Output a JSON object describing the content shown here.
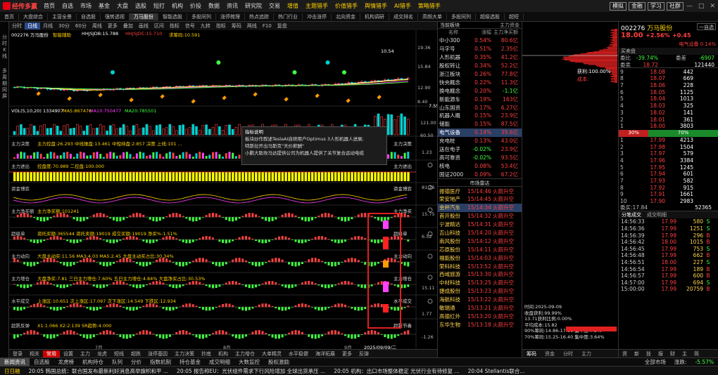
{
  "app": {
    "title": "经传多赢",
    "top_menu": [
      "首页",
      "自选",
      "市场",
      "基金",
      "大盘",
      "选股",
      "短打",
      "机构",
      "价投",
      "数据",
      "资讯",
      "研究院",
      "交易",
      "增值",
      "主题猎手",
      "价值猎手",
      "舆情猎手",
      "AI猎手",
      "策略猎手"
    ],
    "top_right_btns": [
      "模拟",
      "金融",
      "学习",
      "社群"
    ],
    "second_tabs": [
      "首页",
      "大盘综合",
      "主营全景",
      "自选股",
      "强势透视",
      "万马股份",
      "智能选股",
      "多股同列",
      "涨停梳理",
      "热点追踪",
      "热门行业",
      "冲击涨停",
      "北向资金",
      "机构调研",
      "成交排名",
      "高频大单",
      "多股同列",
      "超级选股",
      "超短"
    ],
    "left_strip": [
      "分",
      "时",
      "K",
      "线",
      "多",
      "周",
      "期",
      "同",
      "屏"
    ]
  },
  "chart": {
    "toolbar": [
      "分时",
      "日线",
      "月线",
      "30分",
      "60分",
      "周线",
      "更多",
      "叠加",
      "画线",
      "区间",
      "指标",
      "信号",
      "九转",
      "指标",
      "筹码",
      "两线",
      "F10",
      "复盘"
    ],
    "title_code": "002276 万马股份",
    "smart": "智能辅助",
    "ma_labels": [
      {
        "text": "HHJSJDB:15.788",
        "color": "#ffffff"
      },
      {
        "text": "HHJSJDC:15.710",
        "color": "#ff4040"
      },
      {
        "text": "求筹码:10.591",
        "color": "#ffd200"
      }
    ],
    "price_ticks": [
      "19.36",
      "15.84",
      "12.90",
      "8.40"
    ],
    "annotations": [
      "10.54",
      "7.55"
    ],
    "vol_title": "VOL(5,10,20)",
    "vol_vals": [
      {
        "text": "1334907",
        "color": "#ffffff"
      },
      {
        "text": "MA5:867476",
        "color": "#ffd200"
      },
      {
        "text": "MA10:750477",
        "color": "#ff40ff"
      },
      {
        "text": "MA20:785501",
        "color": "#40ff40"
      }
    ],
    "vol_ticks": [
      "121.00",
      "60.50",
      "0"
    ],
    "panels": [
      {
        "name": "主力决策",
        "vals": "主力控盘:26.293 中线操盘:13.461 中短持盘:2.857 决策 上线:101 ...",
        "right": "主力决策"
      },
      {
        "name": "主力进出",
        "vals": "控盘度:70.989 二控盘:100.000",
        "right": "主力进出"
      },
      {
        "name": "资金博弈",
        "vals": "",
        "right": "资金博弈"
      },
      {
        "name": "主力净买额",
        "vals": "主力净买额:101241",
        "right": "主力净买"
      },
      {
        "name": "超级单",
        "vals": "资托买额:365544 资托卖额:19019 成交买额:19019 净买%:1.51%",
        "right": "超级单"
      },
      {
        "name": "主力动向",
        "vals": "大盘主动买:11.56 MA3:4.03 MA5:2.45 大盘主动买占比:30.34%",
        "right": "主力动向"
      },
      {
        "name": "主力增仓",
        "vals": "大盘净买:7.81 三日主力增仓:7.60% 五日主力增仓:4.84% 大盘净买占比:30.53%",
        "right": "主力增仓"
      },
      {
        "name": "水平成交",
        "vals": "上涨区:10.651 次上涨区:17.097 次下涨区:14.549 下跌区:12.934",
        "right": "水平成交"
      },
      {
        "name": "超跌反弹",
        "vals": "X1:1.066 X2:2.139 SR趋势:4.000",
        "right": "超跌节奏"
      }
    ],
    "panel_ticks": [
      "1.23",
      "81.26",
      "15.75",
      "6.52",
      "15.11",
      "1.77",
      "-1.26"
    ],
    "x_axis": [
      "7月",
      "8月",
      "9月",
      "2025/09/09/二"
    ],
    "bottom_tabs": [
      "登录",
      "相关",
      "常用",
      "设置",
      "主力",
      "龙虎",
      "短线",
      "超跌",
      "涨停基因",
      "主力决策",
      "抄底",
      "机构",
      "主力增仓",
      "大单精灵",
      "水平稳健",
      "海洋拓展",
      "更多",
      "反弹"
    ],
    "tooltip": {
      "title": "指标说明",
      "lines": [
        "板块炒作叙述TeslaAI自研用户Optimus 3人形机器人进展;",
        "特斯拉开出马斯克\"天价薪酬\"",
        "小鹏大助攻马达提供公司为机器人提供了关节复合运动电缆"
      ]
    }
  },
  "sector": {
    "header_left": "当前板块",
    "header_right": "主力资金",
    "cols": [
      "名称",
      "涨幅",
      "主力净买额"
    ],
    "rows": [
      {
        "n": "中小300",
        "p": "0.54%",
        "v": "80.6亿"
      },
      {
        "n": "马字号",
        "p": "0.51%",
        "v": "2.35亿"
      },
      {
        "n": "人形机器",
        "p": "0.35%",
        "v": "41.2亿"
      },
      {
        "n": "股权转让",
        "p": "0.34%",
        "v": "52.2亿"
      },
      {
        "n": "浙江板块",
        "p": "0.26%",
        "v": "77.8亿"
      },
      {
        "n": "快充概念",
        "p": "0.22%",
        "v": "11.3亿"
      },
      {
        "n": "换电概念",
        "p": "0.20%",
        "v": "-1.1亿"
      },
      {
        "n": "新能源车",
        "p": "0.19%",
        "v": "163亿"
      },
      {
        "n": "山东国资",
        "p": "0.17%",
        "v": "6.27亿"
      },
      {
        "n": "机器人概",
        "p": "0.15%",
        "v": "23.9亿"
      },
      {
        "n": "储能",
        "p": "0.15%",
        "v": "87.5亿"
      },
      {
        "n": "电气设备",
        "p": "0.14%",
        "v": "39.6亿",
        "sel": true
      },
      {
        "n": "充电桩",
        "p": "0.13%",
        "v": "43.0亿"
      },
      {
        "n": "送在电子",
        "p": "-0.02%",
        "v": "23.9亿"
      },
      {
        "n": "高可靠资",
        "p": "-0.02%",
        "v": "93.5亿"
      },
      {
        "n": "核电",
        "p": "0.08%",
        "v": "53.4亿"
      },
      {
        "n": "国证2000",
        "p": "0.09%",
        "v": "67.2亿"
      }
    ],
    "alert_title": "市场雷达",
    "alerts": [
      {
        "n": "振德医疗",
        "t": "15/14:46",
        "k": "火箭升空"
      },
      {
        "n": "荣安地产",
        "t": "15/14:45",
        "k": "火箭升空"
      },
      {
        "n": "金杯汽车",
        "t": "15/14:34",
        "k": "火箭升空",
        "sel": true
      },
      {
        "n": "首开股份",
        "t": "15/14:32",
        "k": "火箭升空"
      },
      {
        "n": "宁波精达",
        "t": "15/14:31",
        "k": "火箭升空"
      },
      {
        "n": "吉山科技",
        "t": "15/14:20",
        "k": "火箭升空"
      },
      {
        "n": "南风股份",
        "t": "15/14:12",
        "k": "火箭升空"
      },
      {
        "n": "芯原股份",
        "t": "15/14:11",
        "k": "火箭升空"
      },
      {
        "n": "福能股份",
        "t": "15/14:03",
        "k": "火箭升空"
      },
      {
        "n": "荣科科技",
        "t": "15/13:52",
        "k": "火箭升空"
      },
      {
        "n": "西域旅游",
        "t": "15/13:30",
        "k": "火箭升空"
      },
      {
        "n": "中材科技",
        "t": "15/13:25",
        "k": "火箭升空"
      },
      {
        "n": "捷成股份",
        "t": "15/13:23",
        "k": "火箭升空"
      },
      {
        "n": "海航科技",
        "t": "15/13:22",
        "k": "火箭升空"
      },
      {
        "n": "敏瑞通",
        "t": "15/13:21",
        "k": "火箭升空"
      },
      {
        "n": "高德红外",
        "t": "15/13:20",
        "k": "火箭升空"
      },
      {
        "n": "东华生物",
        "t": "15/13:18",
        "k": "火箭升空"
      }
    ]
  },
  "mid": {
    "chips_label": "获利:100.00%",
    "chips_label2": "成本:",
    "bottom_title": "时间:2025-09-09",
    "bottom_lines": [
      "收盘获利:99.99%",
      "13.71获利比例:0.00%",
      "平均成本:15.82",
      "90%筹码:14.86-17.11 集中度:7.2%",
      "70%筹码:15.25-16.40 集中度:3.64%"
    ],
    "bottom_tabs": [
      "筹码",
      "资金",
      "分时",
      "主力"
    ],
    "bottom_tab2": "获利比例:99.99%"
  },
  "rp": {
    "code": "002276",
    "name": "万马股份",
    "btn": "一自选",
    "price": "18.00",
    "chg": "+2.56%",
    "chg_abs": "+0.45",
    "hdr_left": "买卖盘",
    "hdr_right": "电气设备 0.14%",
    "summary": [
      {
        "l": "委比",
        "v": "-39.74%",
        "l2": "委差",
        "v2": "-6907"
      },
      {
        "l": "委卖",
        "v": "18.72",
        "v2": "121440"
      }
    ],
    "sells": [
      {
        "l": "9",
        "p": "18.08",
        "v": "442",
        "v2": ""
      },
      {
        "l": "8",
        "p": "18.07",
        "v": "669",
        "v2": ""
      },
      {
        "l": "7",
        "p": "18.06",
        "v": "228",
        "v2": ""
      },
      {
        "l": "6",
        "p": "18.05",
        "v": "1125",
        "v2": ""
      },
      {
        "l": "5",
        "p": "18.04",
        "v": "1013",
        "v2": ""
      },
      {
        "l": "4",
        "p": "18.03",
        "v": "325",
        "v2": ""
      },
      {
        "l": "3",
        "p": "18.02",
        "v": "141",
        "v2": ""
      },
      {
        "l": "2",
        "p": "18.01",
        "v": "361",
        "v2": ""
      },
      {
        "l": "1",
        "p": "18.00",
        "v": "3803",
        "v2": ""
      }
    ],
    "ratio_left": "30%",
    "ratio_right": "70%",
    "buys": [
      {
        "l": "1",
        "p": "17.99",
        "v": "4213"
      },
      {
        "l": "2",
        "p": "17.98",
        "v": "1504"
      },
      {
        "l": "3",
        "p": "17.97",
        "v": "579"
      },
      {
        "l": "4",
        "p": "17.96",
        "v": "3384"
      },
      {
        "l": "5",
        "p": "17.95",
        "v": "1245"
      },
      {
        "l": "6",
        "p": "17.94",
        "v": "601"
      },
      {
        "l": "7",
        "p": "17.93",
        "v": "582"
      },
      {
        "l": "8",
        "p": "17.92",
        "v": "915"
      },
      {
        "l": "9",
        "p": "17.91",
        "v": "1661"
      },
      {
        "l": "10",
        "p": "17.90",
        "v": "2983"
      }
    ],
    "buy_sum": {
      "l": "委买:17.84",
      "v": "52365"
    },
    "trade_hdr": [
      "分笔成交",
      "成交明细"
    ],
    "trades": [
      {
        "t": "14:56:33",
        "p": "17.99",
        "v": "580",
        "d": "S"
      },
      {
        "t": "14:56:36",
        "p": "17.99",
        "v": "1251",
        "d": "S"
      },
      {
        "t": "14:56:39",
        "p": "17.99",
        "v": "296",
        "d": "B"
      },
      {
        "t": "14:56:42",
        "p": "18.00",
        "v": "1015",
        "d": "B"
      },
      {
        "t": "14:56:45",
        "p": "17.99",
        "v": "753",
        "d": "S"
      },
      {
        "t": "14:56:48",
        "p": "17.99",
        "v": "662",
        "d": "B"
      },
      {
        "t": "14:56:51",
        "p": "18.00",
        "v": "227",
        "d": "S"
      },
      {
        "t": "14:56:54",
        "p": "17.99",
        "v": "189",
        "d": "B"
      },
      {
        "t": "14:56:57",
        "p": "17.99",
        "v": "600",
        "d": "B"
      },
      {
        "t": "14:57:00",
        "p": "17.99",
        "v": "694",
        "d": "S"
      },
      {
        "t": "15:00:00",
        "p": "17.99",
        "v": "20759",
        "d": "B"
      }
    ],
    "bottom_tabs": [
      "资",
      "新",
      "技",
      "报",
      "财",
      "主",
      "简"
    ]
  },
  "bottom_bar": {
    "tabs": [
      "新闻资讯",
      "自选股",
      "龙虎榜",
      "机构持仓",
      "队列",
      "分价",
      "指数机制",
      "持仓基金",
      "成交明细",
      "大数监控",
      "股权激励"
    ],
    "extra": [
      "全部市场",
      "涨跌:",
      "-5.57%"
    ]
  },
  "ticker": [
    "日日融",
    "20:05 韩国总统：联合国发布最新利好消息高举旗帜和平 ...",
    "20:05 报告称EU：光伏组件需求下行风险增加 全球出货承压 ...",
    "20:05 机构：出口市场整体稳定 光伏行业有待修复 ...",
    "20:04 Stellantis联合..."
  ],
  "colors": {
    "up": "#ff4040",
    "down": "#40ff40",
    "yellow": "#ffd200",
    "magenta": "#ff40ff",
    "cyan": "#00e5ff",
    "sel": "#2a3f66"
  }
}
